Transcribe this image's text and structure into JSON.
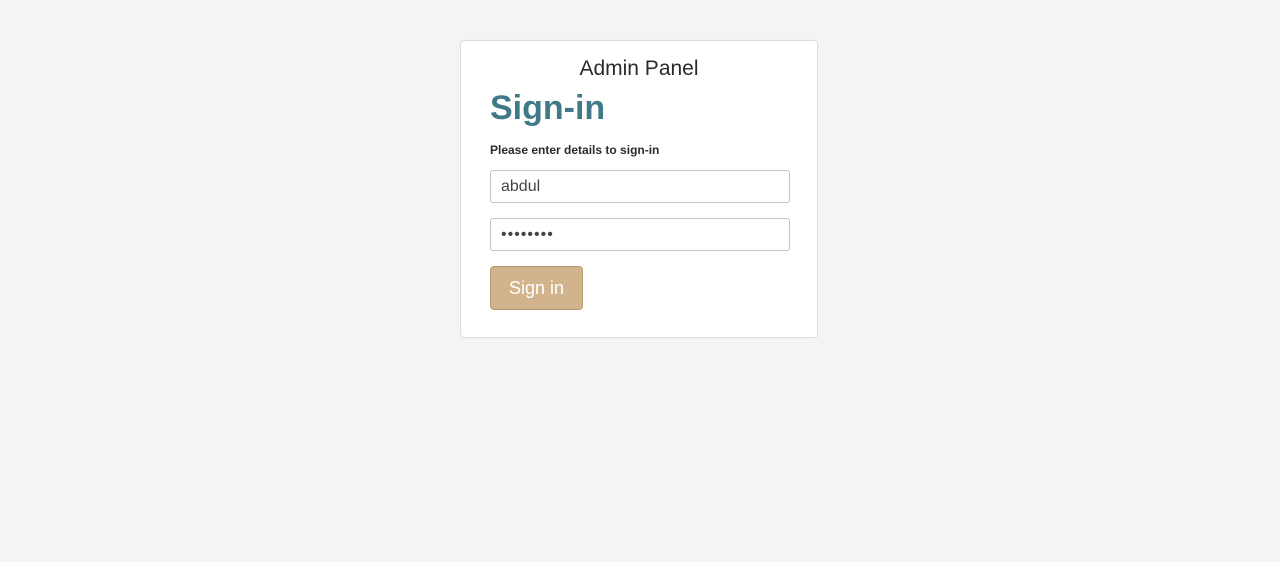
{
  "login": {
    "panel_title": "Admin Panel",
    "heading": "Sign-in",
    "instructions": "Please enter details to sign-in",
    "username_value": "abdul",
    "password_value": "abcdefgh",
    "submit_label": "Sign in"
  },
  "colors": {
    "background": "#f4f4f4",
    "heading": "#3f7a86",
    "button": "#d2b48c"
  }
}
